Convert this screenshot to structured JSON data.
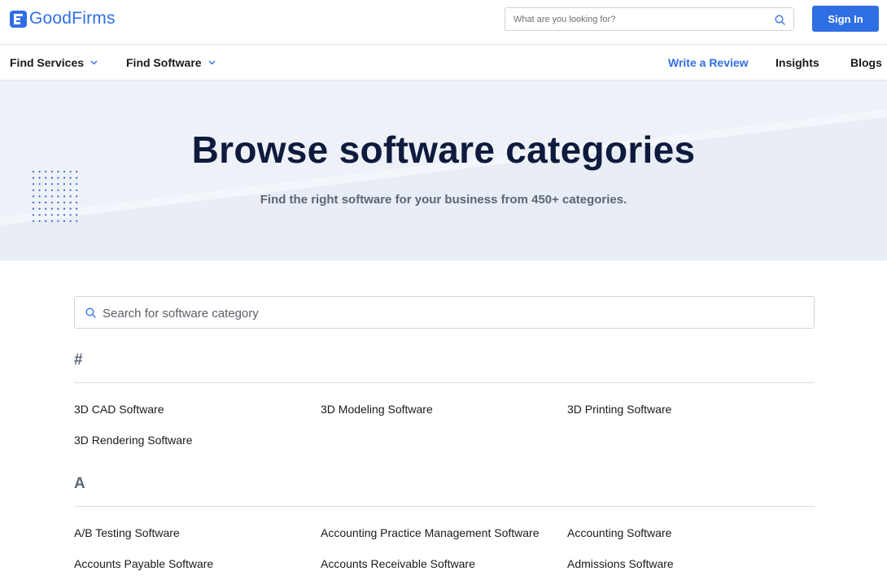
{
  "header": {
    "logo_text": "GoodFirms",
    "search_placeholder": "What are you looking for?",
    "sign_in_label": "Sign In"
  },
  "nav": {
    "find_services": "Find Services",
    "find_software": "Find Software",
    "write_review": "Write a Review",
    "insights": "Insights",
    "blogs": "Blogs"
  },
  "hero": {
    "title": "Browse software categories",
    "subtitle": "Find the right software for your business from 450+ categories."
  },
  "category_search": {
    "placeholder": "Search for software category"
  },
  "sections": [
    {
      "letter": "#",
      "items": [
        "3D CAD Software",
        "3D Modeling Software",
        "3D Printing Software",
        "3D Rendering Software"
      ]
    },
    {
      "letter": "A",
      "items": [
        "A/B Testing Software",
        "Accounting Practice Management Software",
        "Accounting Software",
        "Accounts Payable Software",
        "Accounts Receivable Software",
        "Admissions Software"
      ]
    }
  ],
  "colors": {
    "brand": "#2f6fe4",
    "hero_bg": "#eef2f8",
    "title": "#0e1b3d"
  }
}
